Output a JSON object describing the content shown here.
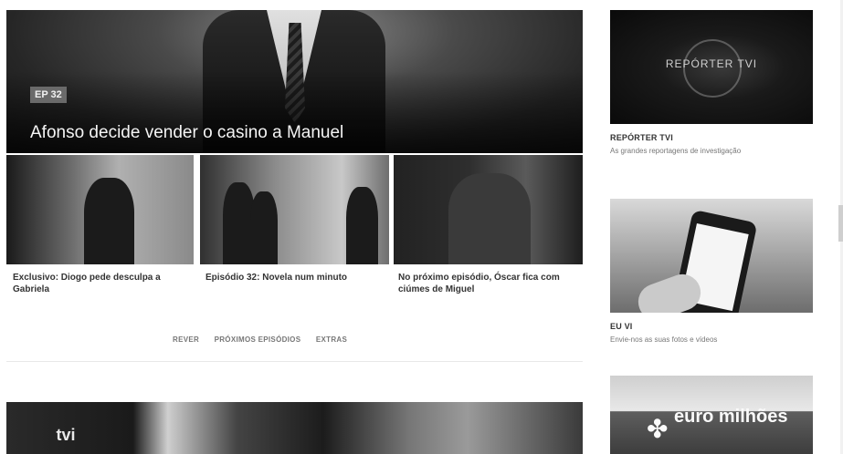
{
  "hero": {
    "badge": "EP 32",
    "title": "Afonso decide vender o casino a Manuel"
  },
  "thumbnails": [
    {
      "caption": "Exclusivo: Diogo pede desculpa a Gabriela"
    },
    {
      "caption": "Episódio 32: Novela num minuto"
    },
    {
      "caption": "No próximo episódio, Óscar fica com ciúmes de Miguel"
    }
  ],
  "tabs": [
    "REVER",
    "PRÓXIMOS EPISÓDIOS",
    "EXTRAS"
  ],
  "bottom": {
    "logo_text": "tvi"
  },
  "sidebar": {
    "items": [
      {
        "logo_text": "REPÓRTER TVI",
        "title": "REPÓRTER TVI",
        "description": "As grandes reportagens de investigação"
      },
      {
        "title": "EU VI",
        "description": "Envie-nos as suas fotos e vídeos"
      },
      {
        "logo_text": "euro milhões",
        "title": "",
        "description": ""
      }
    ]
  },
  "colors": {
    "accent": "#6a6a6a",
    "background": "#ffffff"
  }
}
